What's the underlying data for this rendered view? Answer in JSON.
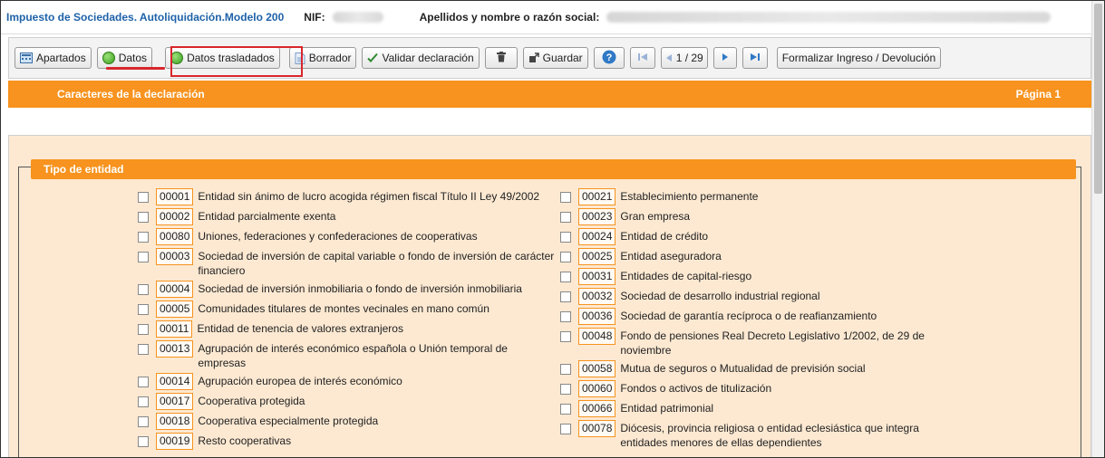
{
  "header": {
    "app_title": "Impuesto de Sociedades. Autoliquidación.Modelo 200",
    "nif_label": "NIF:",
    "name_label": "Apellidos y nombre o razón social:"
  },
  "toolbar": {
    "apartados": "Apartados",
    "datos": "Datos",
    "datos_trasladados": "Datos trasladados",
    "borrador": "Borrador",
    "validar": "Validar declaración",
    "guardar": "Guardar",
    "page_indicator": "1 / 29",
    "formalizar": "Formalizar Ingreso / Devolución"
  },
  "section_bar": {
    "title": "Caracteres de la declaración",
    "page": "Página 1"
  },
  "entity": {
    "legend": "Tipo de entidad",
    "left": [
      {
        "code": "00001",
        "label": "Entidad sin ánimo de lucro acogida régimen fiscal Título II Ley 49/2002"
      },
      {
        "code": "00002",
        "label": "Entidad parcialmente exenta"
      },
      {
        "code": "00080",
        "label": "Uniones, federaciones y confederaciones de cooperativas"
      },
      {
        "code": "00003",
        "label": "Sociedad de inversión de capital variable o fondo de inversión de carácter financiero"
      },
      {
        "code": "00004",
        "label": "Sociedad de inversión inmobiliaria o fondo de inversión inmobiliaria"
      },
      {
        "code": "00005",
        "label": "Comunidades titulares de montes vecinales en mano común"
      },
      {
        "code": "00011",
        "label": "Entidad de tenencia de valores extranjeros"
      },
      {
        "code": "00013",
        "label": "Agrupación de interés económico española o Unión temporal de empresas"
      },
      {
        "code": "00014",
        "label": "Agrupación europea de interés económico"
      },
      {
        "code": "00017",
        "label": "Cooperativa protegida"
      },
      {
        "code": "00018",
        "label": "Cooperativa especialmente protegida"
      },
      {
        "code": "00019",
        "label": "Resto cooperativas"
      }
    ],
    "right": [
      {
        "code": "00021",
        "label": "Establecimiento permanente"
      },
      {
        "code": "00023",
        "label": "Gran empresa"
      },
      {
        "code": "00024",
        "label": "Entidad de crédito"
      },
      {
        "code": "00025",
        "label": "Entidad aseguradora"
      },
      {
        "code": "00031",
        "label": "Entidades de capital-riesgo"
      },
      {
        "code": "00032",
        "label": "Sociedad de desarrollo industrial regional"
      },
      {
        "code": "00036",
        "label": "Sociedad de garantía recíproca o de reafianzamiento"
      },
      {
        "code": "00048",
        "label": "Fondo de pensiones Real Decreto Legislativo 1/2002, de 29 de noviembre"
      },
      {
        "code": "00058",
        "label": "Mutua de seguros o Mutualidad de previsión social"
      },
      {
        "code": "00060",
        "label": "Fondos o activos de titulización"
      },
      {
        "code": "00066",
        "label": "Entidad patrimonial"
      },
      {
        "code": "00078",
        "label": "Diócesis, provincia religiosa o entidad eclesiástica que integra entidades menores de ellas dependientes"
      }
    ]
  },
  "colors": {
    "orange": "#f7931e",
    "panel": "#fde9d2",
    "highlight_red": "#d9262c",
    "title_blue": "#1e62a8"
  }
}
